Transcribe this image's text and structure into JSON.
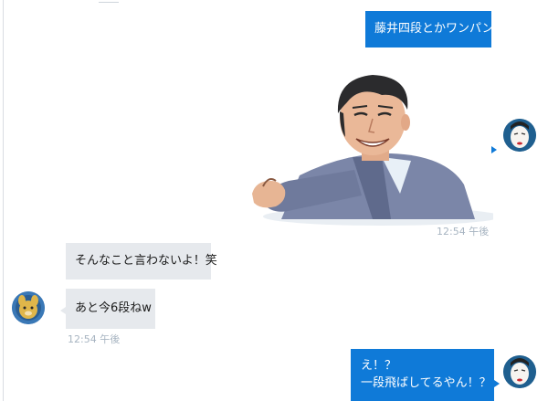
{
  "messages": {
    "m1_text": "藤井四段とかワンパン",
    "m2_sticker": "manga-sticker-smiling-man-pointing",
    "m2_time": "12:54 午後",
    "m3_text": "そんなこと言わないよ！笑",
    "m4_text": "あと今6段ねw",
    "m4_time": "12:54 午後",
    "m5_line1": "え！？",
    "m5_line2": "一段飛ばしてるやん！？"
  },
  "colors": {
    "outgoing_bubble": "#0f7ad8",
    "incoming_bubble": "#e6e9ed",
    "timestamp": "#a7b4c1"
  },
  "icons": {
    "self_avatar": "kabuki-face-avatar",
    "other_avatar": "cartoon-animal-avatar"
  }
}
